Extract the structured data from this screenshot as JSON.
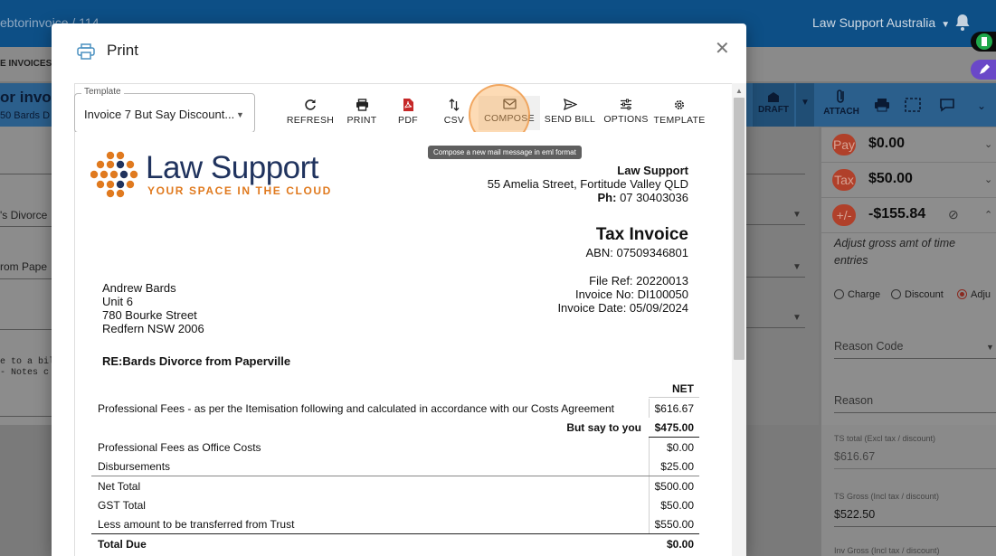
{
  "background": {
    "breadcrumb": "ebtorinvoice / 114",
    "org_name": "Law Support Australia",
    "tab_label": "E INVOICES",
    "header_title": "or invoid",
    "header_sub": "50 Bards D",
    "left_fields": [
      "'s Divorce",
      "rom Pape"
    ],
    "notes_lines": [
      "e to a bil",
      "- Notes c"
    ],
    "toolbar": {
      "draft_label": "DRAFT",
      "attach_label": "ATTACH"
    },
    "summary": [
      {
        "badge": "Pay",
        "value": "$0.00"
      },
      {
        "badge": "Tax",
        "value": "$50.00"
      },
      {
        "badge": "+/-",
        "value": "-$155.84"
      }
    ],
    "adjust_note": "Adjust gross amt of time entries",
    "radio_options": [
      {
        "label": "Charge",
        "selected": false
      },
      {
        "label": "Discount",
        "selected": false
      },
      {
        "label": "Adju",
        "selected": true
      }
    ],
    "reason_code_label": "Reason Code",
    "reason_label": "Reason",
    "ts_total_label": "TS total (Excl tax / discount)",
    "ts_total_value": "$616.67",
    "ts_gross_label": "TS Gross (Incl tax / discount)",
    "ts_gross_value": "$522.50",
    "inv_gross_label": "Inv Gross (Incl tax / discount)"
  },
  "dialog": {
    "title": "Print",
    "template_label": "Template",
    "template_value": "Invoice 7 But Say Discount...",
    "toolbar": [
      {
        "id": "refresh",
        "label": "REFRESH",
        "icon": "refresh-icon"
      },
      {
        "id": "print",
        "label": "PRINT",
        "icon": "printer-icon"
      },
      {
        "id": "pdf",
        "label": "PDF",
        "icon": "pdf-icon"
      },
      {
        "id": "csv",
        "label": "CSV",
        "icon": "sort-arrows-icon"
      },
      {
        "id": "compose",
        "label": "COMPOSE",
        "icon": "mail-icon"
      },
      {
        "id": "send_bill",
        "label": "SEND BILL",
        "icon": "send-icon"
      },
      {
        "id": "options",
        "label": "OPTIONS",
        "icon": "sliders-icon"
      },
      {
        "id": "template",
        "label": "TEMPLATE",
        "icon": "gear-icon"
      }
    ],
    "tooltip": "Compose a new mail message in eml format"
  },
  "invoice": {
    "logo_main": "Law Support",
    "logo_tagline": "YOUR SPACE IN THE CLOUD",
    "company_name": "Law Support",
    "company_address": "55 Amelia Street, Fortitude Valley QLD",
    "company_phone_label": "Ph:",
    "company_phone": "07 30403036",
    "doc_title": "Tax Invoice",
    "abn": "ABN: 07509346801",
    "file_ref": "File Ref: 20220013",
    "invoice_no": "Invoice No: DI100050",
    "invoice_date": "Invoice Date: 05/09/2024",
    "client": [
      "Andrew Bards",
      "Unit 6",
      "780 Bourke Street",
      "Redfern NSW 2006"
    ],
    "re_line": "RE:Bards Divorce from Paperville",
    "net_header": "NET",
    "lines": [
      {
        "desc": "Professional Fees - as per the Itemisation following and calculated in accordance with our Costs Agreement",
        "amount": "$616.67"
      },
      {
        "desc": "But say to you",
        "amount": "$475.00"
      },
      {
        "desc": "Professional Fees as Office Costs",
        "amount": "$0.00"
      },
      {
        "desc": "Disbursements",
        "amount": "$25.00"
      },
      {
        "desc": "Net Total",
        "amount": "$500.00"
      },
      {
        "desc": "GST Total",
        "amount": "$50.00"
      },
      {
        "desc": "Less amount to be transferred from Trust",
        "amount": "$550.00"
      },
      {
        "desc": "Total Due",
        "amount": "$0.00"
      }
    ]
  },
  "colors": {
    "topbar": "#0d4f86",
    "logo_orange": "#e07a1f",
    "logo_navy": "#20335e",
    "badge_red": "#b0402a",
    "pdf_red": "#c62828",
    "compose_highlight": "#f7a85a"
  }
}
